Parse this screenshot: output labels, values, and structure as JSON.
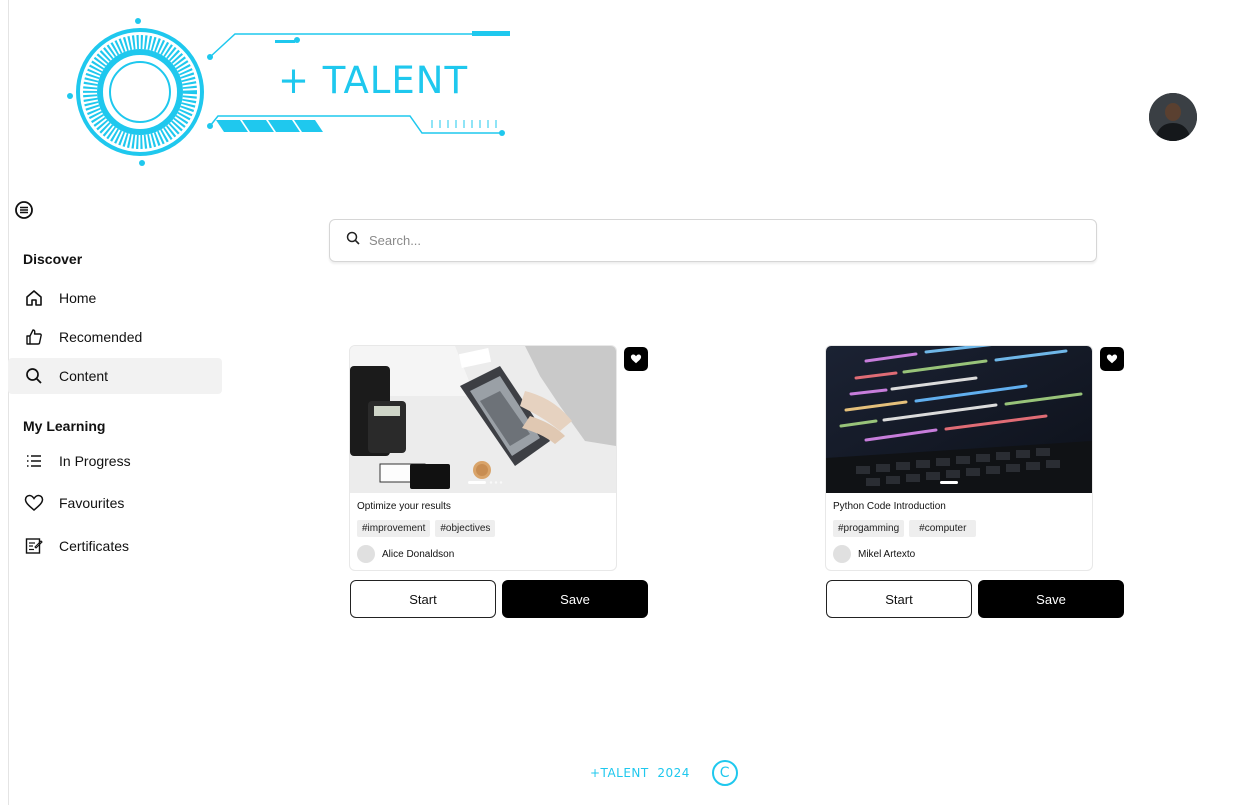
{
  "brand": {
    "logo_text": "+ TALENT",
    "accent_color": "#1fc8ee"
  },
  "user": {
    "avatar_icon": "user-avatar"
  },
  "sidebar": {
    "menu_icon": "menu-circle-icon",
    "sections": [
      {
        "title": "Discover",
        "items": [
          {
            "label": "Home",
            "icon": "home-icon"
          },
          {
            "label": "Recomended",
            "icon": "thumbs-up-icon"
          },
          {
            "label": "Content",
            "icon": "search-icon",
            "active": true
          }
        ]
      },
      {
        "title": "My Learning",
        "items": [
          {
            "label": "In Progress",
            "icon": "list-icon"
          },
          {
            "label": "Favourites",
            "icon": "heart-icon"
          },
          {
            "label": "Certificates",
            "icon": "certificate-icon"
          }
        ]
      }
    ]
  },
  "search": {
    "placeholder": "Search..."
  },
  "cards": [
    {
      "title": "Optimize your results",
      "tags": [
        "#improvement",
        "#objectives"
      ],
      "author": "Alice Donaldson",
      "start_label": "Start",
      "save_label": "Save"
    },
    {
      "title": "Python Code Introduction",
      "tags": [
        "#progamming",
        "#computer"
      ],
      "author": "Mikel Artexto",
      "start_label": "Start",
      "save_label": "Save"
    }
  ],
  "footer": {
    "text": "+TALENT  2024",
    "copyright_symbol": "C"
  }
}
